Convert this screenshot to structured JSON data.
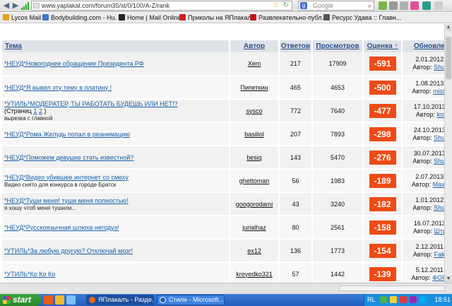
{
  "browser": {
    "url": "www.yaplakal.com/forum35/st/0/100/A-Z/rank",
    "search_placeholder": "Google",
    "bookmarks": [
      {
        "label": "Lycos Mail",
        "color": "#e8a020"
      },
      {
        "label": "Bodybuilding.com - Hu...",
        "color": "#3a78c8"
      },
      {
        "label": "Home | Mail Online",
        "color": "#222222"
      },
      {
        "label": "Приколы на ЯПлакалъ",
        "color": "#d02020"
      },
      {
        "label": "Развлекательно-публ...",
        "color": "#c01818"
      },
      {
        "label": "Ресурс Удава :: Главн...",
        "color": "#555555"
      }
    ]
  },
  "table": {
    "headers": {
      "topic": "Тема",
      "author": "Автор",
      "replies": "Ответов",
      "views": "Просмотров",
      "rating": "Оценка ↑",
      "updated": "Обновлен"
    },
    "rows": [
      {
        "title": "*НЕУД*Новогоднее обращение Президента РФ",
        "pages_label": "",
        "pages": [],
        "pages_close": "",
        "desc": "",
        "author": "Xem",
        "replies": "217",
        "views": "17909",
        "rating": "-591",
        "upd_date": "2.01.2012 -",
        "upd_label": "Автор:",
        "upd_author": "Shum"
      },
      {
        "title": "*НЕУД*Я вывел эту тему в платину !",
        "pages_label": "",
        "pages": [],
        "pages_close": "",
        "desc": "",
        "author": "Пипеткин",
        "replies": "465",
        "views": "4653",
        "rating": "-500",
        "upd_date": "1.08.2013 -",
        "upd_label": "Автор:",
        "upd_author": "missja"
      },
      {
        "title": "*УТИЛЬ*МОДЕРАТЕР, ТЫ РАБОТАТЬ БУДЕШЬ ИЛИ НЕТ!?",
        "pages_label": "(Страниц",
        "pages": [
          "1",
          "2"
        ],
        "pages_close": ")",
        "desc": "вырезка с главной",
        "author": "sysco",
        "replies": "772",
        "views": "7640",
        "rating": "-477",
        "upd_date": "17.10.2013 -",
        "upd_label": "Автор:",
        "upd_author": "kott"
      },
      {
        "title": "*НЕУД*Рома Желудь попал в реанимацию",
        "pages_label": "",
        "pages": [],
        "pages_close": "",
        "desc": "",
        "author": "basiliol",
        "replies": "207",
        "views": "7893",
        "rating": "-298",
        "upd_date": "24.10.2013 -",
        "upd_label": "Автор:",
        "upd_author": "Shum"
      },
      {
        "title": "*НЕУД*Поможем девушке стать известной?",
        "pages_label": "",
        "pages": [],
        "pages_close": "",
        "desc": "",
        "author": "besiq",
        "replies": "143",
        "views": "5470",
        "rating": "-276",
        "upd_date": "30.07.2013 -",
        "upd_label": "Автор:",
        "upd_author": "Shum"
      },
      {
        "title": "*НЕУД*Видео убившее интернет со смеху",
        "pages_label": "",
        "pages": [],
        "pages_close": "",
        "desc": "Видео снято для конкурса в городе Братск",
        "author": "ghettoman",
        "replies": "56",
        "views": "1983",
        "rating": "-189",
        "upd_date": "2.07.2013 -",
        "upd_label": "Автор:",
        "upd_author": "Maxim"
      },
      {
        "title": "*НЕУД*Туши меня! туши меня полностью!",
        "pages_label": "",
        "pages": [],
        "pages_close": "",
        "desc": "я хошу чтоб меня тушили...",
        "author": "googorodami",
        "replies": "43",
        "views": "3240",
        "rating": "-182",
        "upd_date": "1.01.2012 -",
        "upd_label": "Автор:",
        "upd_author": "Shum"
      },
      {
        "title": "*НЕУД*Русскоязычная шлюха негодуэ!",
        "pages_label": "",
        "pages": [],
        "pages_close": "",
        "desc": "",
        "author": "jurialhaz",
        "replies": "80",
        "views": "2561",
        "rating": "-158",
        "upd_date": "16.07.2013 -",
        "upd_label": "Автор:",
        "upd_author": "Штир"
      },
      {
        "title": "*УТИЛЬ*За любую другую? Отключай мозг!",
        "pages_label": "",
        "pages": [],
        "pages_close": "",
        "desc": "",
        "author": "ex12",
        "replies": "136",
        "views": "1773",
        "rating": "-154",
        "upd_date": "2.12.2011 -",
        "upd_label": "Автор:",
        "upd_author": "Faktu"
      },
      {
        "title": "*УТИЛЬ*Ко Ко Ко",
        "pages_label": "",
        "pages": [],
        "pages_close": "",
        "desc": "",
        "author": "kreyedko321",
        "replies": "57",
        "views": "1442",
        "rating": "-139",
        "upd_date": "5.12.2011 -",
        "upd_label": "Автор:",
        "upd_author": "ФОРМ"
      }
    ]
  },
  "colors": {
    "rating_badge": "#ee4b16",
    "link": "#1a5fa7",
    "header_bg": "#dfe3e8"
  },
  "taskbar": {
    "start_label": "start",
    "tasks": [
      {
        "label": "ЯПлакалъ - Разде...",
        "active": true
      },
      {
        "label": "Стили - Microsoft...",
        "active": false
      }
    ],
    "tray_lang": "RL",
    "clock": "18:51"
  }
}
